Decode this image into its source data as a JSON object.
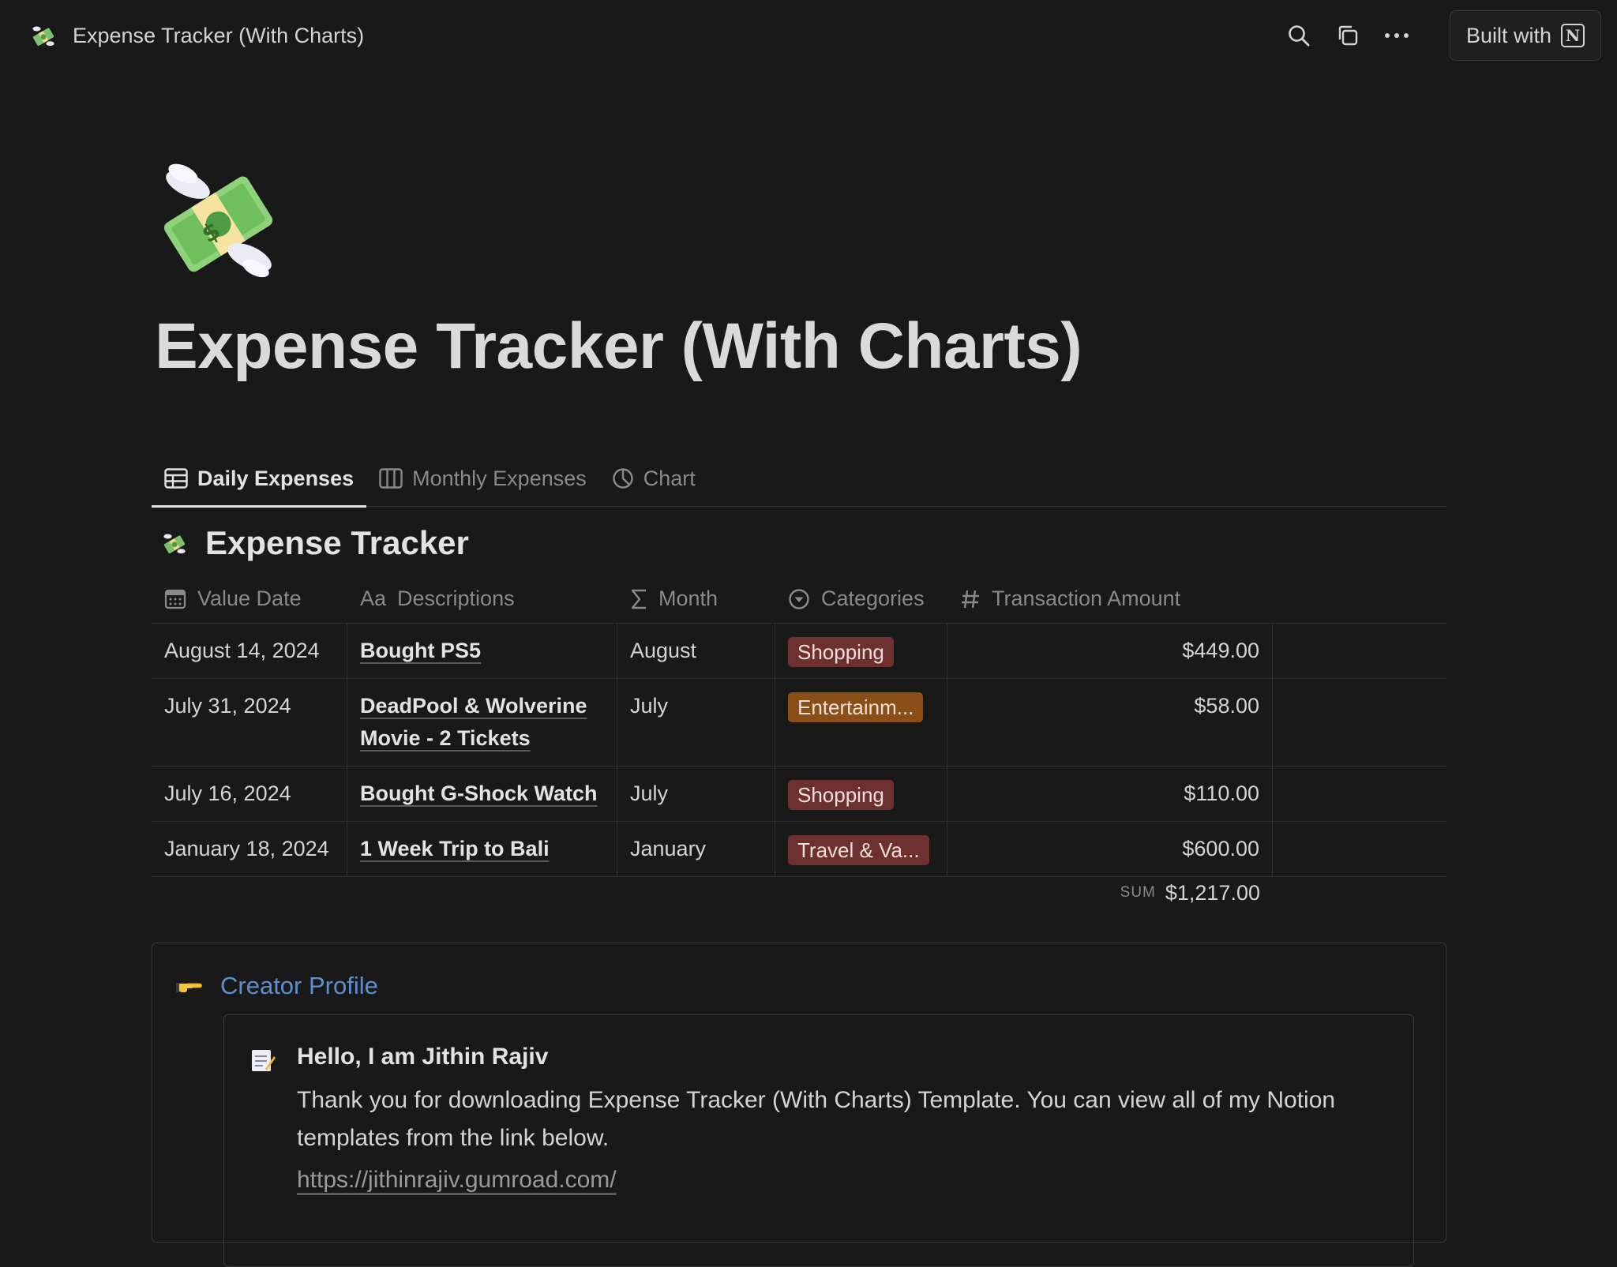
{
  "topbar": {
    "breadcrumb": "Expense Tracker (With Charts)",
    "built_with": "Built with",
    "notion_glyph": "N"
  },
  "page": {
    "title": "Expense Tracker (With Charts)"
  },
  "tabs": [
    {
      "label": "Daily Expenses",
      "icon": "table-icon",
      "active": true
    },
    {
      "label": "Monthly Expenses",
      "icon": "board-icon",
      "active": false
    },
    {
      "label": "Chart",
      "icon": "pie-chart-icon",
      "active": false
    }
  ],
  "database": {
    "title": "Expense Tracker",
    "columns": {
      "value_date": "Value Date",
      "descriptions": "Descriptions",
      "month": "Month",
      "categories": "Categories",
      "amount": "Transaction Amount",
      "aa_glyph": "Aa"
    },
    "rows": [
      {
        "date": "August 14, 2024",
        "desc1": "Bought PS5",
        "desc2": "",
        "month": "August",
        "category": "Shopping",
        "amount": "$449.00"
      },
      {
        "date": "July 31, 2024",
        "desc1": "DeadPool & Wolverine",
        "desc2": "Movie - 2 Tickets",
        "month": "July",
        "category": "Entertainm...",
        "amount": "$58.00"
      },
      {
        "date": "July 16, 2024",
        "desc1": "Bought G-Shock Watch",
        "desc2": "",
        "month": "July",
        "category": "Shopping",
        "amount": "$110.00"
      },
      {
        "date": "January 18, 2024",
        "desc1": "1 Week Trip to Bali",
        "desc2": "",
        "month": "January",
        "category": "Travel & Va...",
        "amount": "$600.00"
      }
    ],
    "sum_label": "SUM",
    "sum_value": "$1,217.00"
  },
  "colors": {
    "shopping": "#6e2f2f",
    "entertainment": "#8a4f17",
    "travel": "#6e2f2f",
    "link_blue": "#5d8fd0"
  },
  "callout": {
    "link": "Creator Profile",
    "hello": "Hello, I am Jithin Rajiv",
    "thanks": "Thank you for downloading Expense Tracker (With Charts) Template. You can view all of my Notion templates from the link below.",
    "url": "https://jithinrajiv.gumroad.com/"
  }
}
